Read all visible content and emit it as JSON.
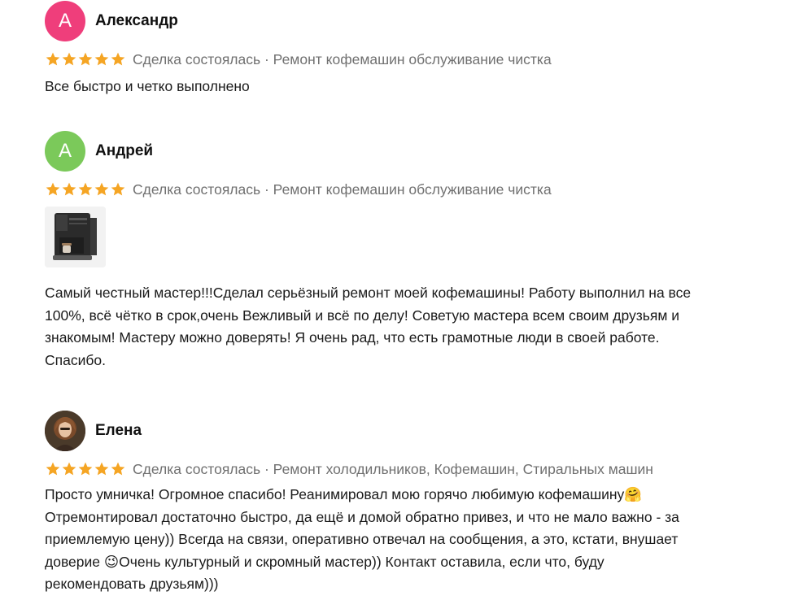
{
  "colors": {
    "star": "#f5a524",
    "meta_text": "#707070",
    "avatar_alexander": "#ef3e7b",
    "avatar_andrey": "#7bc95a"
  },
  "reviews": [
    {
      "avatar_letter": "А",
      "author": "Александр",
      "rating": 5,
      "meta": "Сделка состоялась · Ремонт кофемашин обслуживание чистка",
      "text": "Все быстро и четко выполнено"
    },
    {
      "avatar_letter": "А",
      "author": "Андрей",
      "rating": 5,
      "meta": "Сделка состоялась · Ремонт кофемашин обслуживание чистка",
      "photo_icon": "coffee-machine-photo",
      "text": "Самый честный мастер!!!Сделал серьёзный ремонт моей кофемашины! Работу выполнил на все\n100%, всё чётко в срок,очень Вежливый и всё по делу! Советую мастера всем своим друзьям и\nзнакомым! Мастеру можно доверять! Я очень рад, что есть грамотные люди в своей работе.\nСпасибо."
    },
    {
      "avatar_icon": "user-photo-avatar",
      "author": "Елена",
      "rating": 5,
      "meta": "Сделка состоялась · Ремонт холодильников, Кофемашин, Стиральных машин",
      "text": "Просто умничка! Огромное спасибо! Реанимировал мою горячо любимую кофемашину🤗\nОтремонтировал достаточно быстро, да ещё и домой обратно привез, и что не мало важно - за\nприемлемую цену)) Всегда на связи, оперативно отвечал на сообщения, а это, кстати, внушает\nдоверие 😉Очень культурный и скромный мастер)) Контакт оставила, если что, буду\nрекомендовать друзьям)))"
    }
  ]
}
